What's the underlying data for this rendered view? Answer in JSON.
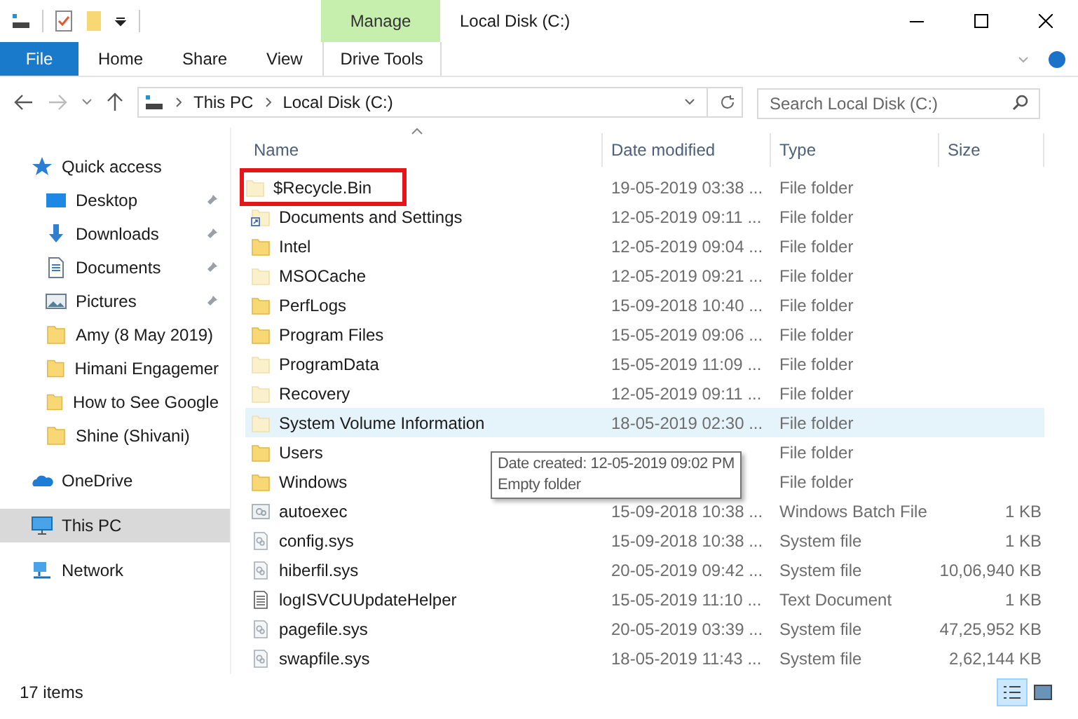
{
  "window": {
    "title": "Local Disk (C:)"
  },
  "ribbon": {
    "context_group": "Manage",
    "tabs": [
      {
        "label": "File",
        "kind": "file",
        "selected": false
      },
      {
        "label": "Home",
        "kind": "tab",
        "selected": false
      },
      {
        "label": "Share",
        "kind": "tab",
        "selected": false
      },
      {
        "label": "View",
        "kind": "tab",
        "selected": false
      },
      {
        "label": "Drive Tools",
        "kind": "context",
        "selected": false
      }
    ]
  },
  "address": {
    "crumbs": [
      "This PC",
      "Local Disk (C:)"
    ],
    "search_placeholder": "Search Local Disk (C:)"
  },
  "sidebar": {
    "items": [
      {
        "label": "Quick access",
        "kind": "star",
        "pinned": false,
        "selected": false,
        "children": [
          {
            "label": "Desktop",
            "kind": "desktop",
            "pinned": true,
            "selected": false
          },
          {
            "label": "Downloads",
            "kind": "download",
            "pinned": true,
            "selected": false
          },
          {
            "label": "Documents",
            "kind": "documents",
            "pinned": true,
            "selected": false
          },
          {
            "label": "Pictures",
            "kind": "pictures",
            "pinned": true,
            "selected": false
          },
          {
            "label": "Amy (8 May 2019)",
            "kind": "folder",
            "pinned": false,
            "selected": false
          },
          {
            "label": "Himani Engagemer",
            "kind": "folder",
            "pinned": false,
            "selected": false
          },
          {
            "label": "How to See Google",
            "kind": "folder",
            "pinned": false,
            "selected": false
          },
          {
            "label": "Shine (Shivani)",
            "kind": "folder",
            "pinned": false,
            "selected": false
          }
        ]
      },
      {
        "label": "OneDrive",
        "kind": "cloud",
        "pinned": false,
        "selected": false
      },
      {
        "label": "This PC",
        "kind": "pc",
        "pinned": false,
        "selected": true
      },
      {
        "label": "Network",
        "kind": "network",
        "pinned": false,
        "selected": false
      }
    ]
  },
  "table": {
    "columns": [
      "Name",
      "Date modified",
      "Type",
      "Size"
    ],
    "rows": [
      {
        "name": "$Recycle.Bin",
        "date": "19-05-2019 03:38 ...",
        "type": "File folder",
        "kind": "hidden_folder",
        "hovered": false,
        "outlined": true
      },
      {
        "name": "Documents and Settings",
        "date": "12-05-2019 09:11 ...",
        "type": "File folder",
        "kind": "shortcut",
        "hovered": false,
        "outlined": false
      },
      {
        "name": "Intel",
        "date": "12-05-2019 09:04 ...",
        "type": "File folder",
        "kind": "folder",
        "hovered": false,
        "outlined": false
      },
      {
        "name": "MSOCache",
        "date": "12-05-2019 09:21 ...",
        "type": "File folder",
        "kind": "hidden_folder",
        "hovered": false,
        "outlined": false
      },
      {
        "name": "PerfLogs",
        "date": "15-09-2018 10:40 ...",
        "type": "File folder",
        "kind": "folder",
        "hovered": false,
        "outlined": false
      },
      {
        "name": "Program Files",
        "date": "15-05-2019 09:06 ...",
        "type": "File folder",
        "kind": "folder",
        "hovered": false,
        "outlined": false
      },
      {
        "name": "ProgramData",
        "date": "15-05-2019 11:09 ...",
        "type": "File folder",
        "kind": "hidden_folder",
        "hovered": false,
        "outlined": false
      },
      {
        "name": "Recovery",
        "date": "12-05-2019 09:11 ...",
        "type": "File folder",
        "kind": "hidden_folder",
        "hovered": false,
        "outlined": false
      },
      {
        "name": "System Volume Information",
        "date": "18-05-2019 02:30 ...",
        "type": "File folder",
        "kind": "hidden_folder",
        "hovered": true,
        "outlined": false
      },
      {
        "name": "Users",
        "type": "File folder",
        "kind": "folder",
        "hovered": false,
        "outlined": false
      },
      {
        "name": "Windows",
        "type": "File folder",
        "kind": "folder",
        "hovered": false,
        "outlined": false
      },
      {
        "name": "autoexec",
        "date": "15-09-2018 10:38 ...",
        "type": "Windows Batch File",
        "size": "1 KB",
        "kind": "batch_file",
        "hovered": false,
        "outlined": false
      },
      {
        "name": "config.sys",
        "date": "15-09-2018 10:38 ...",
        "type": "System file",
        "size": "1 KB",
        "kind": "system_file",
        "hovered": false,
        "outlined": false
      },
      {
        "name": "hiberfil.sys",
        "date": "20-05-2019 09:42 ...",
        "type": "System file",
        "size": "10,06,940 KB",
        "kind": "system_file",
        "hovered": false,
        "outlined": false
      },
      {
        "name": "logISVCUUpdateHelper",
        "date": "15-05-2019 11:10 ...",
        "type": "Text Document",
        "size": "1 KB",
        "kind": "text_file",
        "hovered": false,
        "outlined": false
      },
      {
        "name": "pagefile.sys",
        "date": "20-05-2019 03:39 ...",
        "type": "System file",
        "size": "47,25,952 KB",
        "kind": "system_file",
        "hovered": false,
        "outlined": false
      },
      {
        "name": "swapfile.sys",
        "date": "18-05-2019 11:43 ...",
        "type": "System file",
        "size": "2,62,144 KB",
        "kind": "system_file",
        "hovered": false,
        "outlined": false
      }
    ]
  },
  "tooltip": {
    "lines": [
      "Date created: 12-05-2019 09:02 PM",
      "Empty folder"
    ]
  },
  "status_bar": {
    "count": "17 items",
    "views": [
      {
        "kind": "details",
        "selected": true
      },
      {
        "kind": "thumbnails",
        "selected": false
      }
    ]
  }
}
